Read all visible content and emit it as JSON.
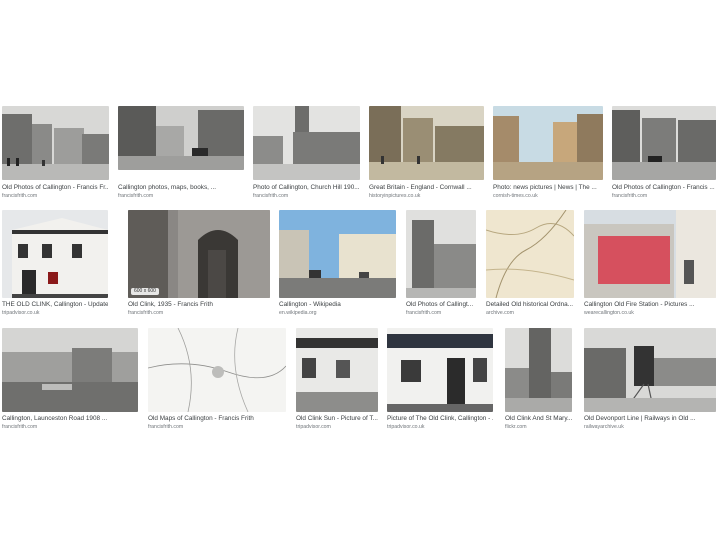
{
  "results": [
    {
      "title": "Old Photos of Callington - Francis Fr...",
      "source": "francisfrith.com",
      "badge": ""
    },
    {
      "title": "Callington photos, maps, books, ...",
      "source": "francisfrith.com",
      "badge": ""
    },
    {
      "title": "Photo of Callington, Church Hill 190...",
      "source": "francisfrith.com",
      "badge": ""
    },
    {
      "title": "Great Britain - England - Cornwall ...",
      "source": "historyinpictures.co.uk",
      "badge": ""
    },
    {
      "title": "Photo: news pictures | News | The ...",
      "source": "cornish-times.co.uk",
      "badge": ""
    },
    {
      "title": "Old Photos of Callington - Francis ...",
      "source": "francisfrith.com",
      "badge": ""
    },
    {
      "title": "THE OLD CLINK, Callington - Updated ...",
      "source": "tripadvisor.co.uk",
      "badge": ""
    },
    {
      "title": "Old Clink, 1935 - Francis Frith",
      "source": "francisfrith.com",
      "badge": "600 x 600"
    },
    {
      "title": "Callington - Wikipedia",
      "source": "en.wikipedia.org",
      "badge": ""
    },
    {
      "title": "Old Photos of Callingt...",
      "source": "francisfrith.com",
      "badge": ""
    },
    {
      "title": "Detailed Old historical Ordna...",
      "source": "archive.com",
      "badge": ""
    },
    {
      "title": "Callington Old Fire Station - Pictures ...",
      "source": "wearecallington.co.uk",
      "badge": ""
    },
    {
      "title": "Callington, Launceston Road 1908 ...",
      "source": "francisfrith.com",
      "badge": ""
    },
    {
      "title": "Old Maps of Callington - Francis Frith",
      "source": "francisfrith.com",
      "badge": ""
    },
    {
      "title": "Old Clink Sun - Picture of T...",
      "source": "tripadvisor.com",
      "badge": ""
    },
    {
      "title": "Picture of The Old Clink, Callington - ...",
      "source": "tripadvisor.co.uk",
      "badge": ""
    },
    {
      "title": "Old Clink And St Mary...",
      "source": "flickr.com",
      "badge": ""
    },
    {
      "title": "Old Devonport Line | Railways in Old ...",
      "source": "railwayarchive.uk",
      "badge": ""
    }
  ],
  "colors": {
    "caption": "#3c4043",
    "source": "#70757a"
  }
}
